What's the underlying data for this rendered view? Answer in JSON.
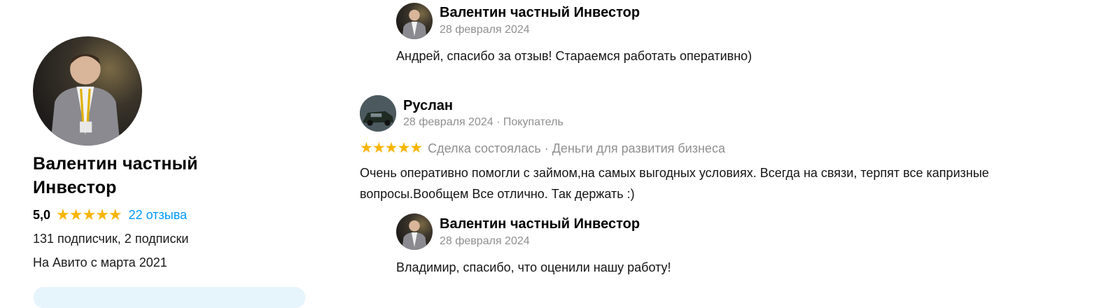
{
  "seller": {
    "name_line1": "Валентин частный",
    "name_line2": "Инвестор",
    "rating": "5,0",
    "stars": "★★★★★",
    "reviews_link": "22 отзыва",
    "followers": "131 подписчик, 2 подписки",
    "since": "На Авито с марта 2021"
  },
  "reply1": {
    "author": "Валентин частный Инвестор",
    "date": "28 февраля 2024",
    "text": "Андрей, спасибо за отзыв! Стараемся работать оперативно)"
  },
  "review": {
    "author": "Руслан",
    "date": "28 февраля 2024 · Покупатель",
    "stars": "★★★★★",
    "deal": "Сделка состоялась · Деньги для развития бизнеса",
    "text_line1": "Очень оперативно помогли с займом,на самых выгодных условиях. Всегда на связи, терпят все капризные",
    "text_line2": "вопросы.Вообщем Все отлично. Так держать :)"
  },
  "reply2": {
    "author": "Валентин частный Инвестор",
    "date": "28 февраля 2024",
    "text": "Владимир, спасибо, что оценили нашу работу!"
  },
  "colors": {
    "star": "#f7b500",
    "link": "#0099f7",
    "muted": "#8f8f8f",
    "banner": "#e6f4fc"
  }
}
